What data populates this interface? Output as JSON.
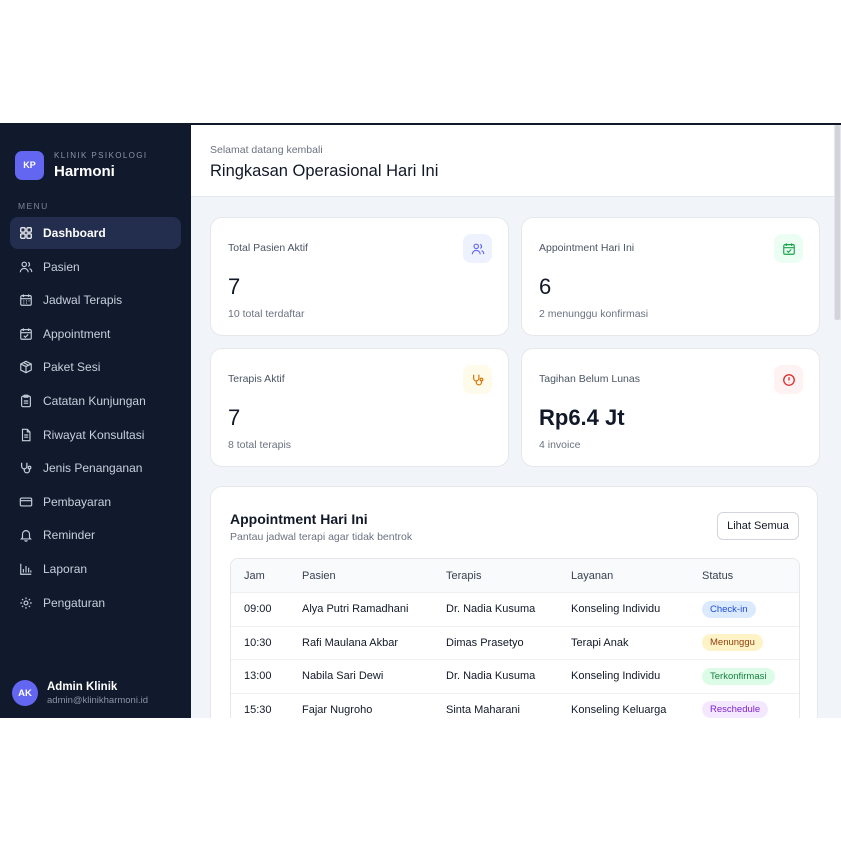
{
  "brand": {
    "logo": "KP",
    "subtitle": "KLINIK PSIKOLOGI",
    "name": "Harmoni"
  },
  "menu_label": "MENU",
  "nav": [
    {
      "label": "Dashboard",
      "icon": "dashboard-icon",
      "active": true
    },
    {
      "label": "Pasien",
      "icon": "users-icon"
    },
    {
      "label": "Jadwal Terapis",
      "icon": "calendar-icon"
    },
    {
      "label": "Appointment",
      "icon": "calendar-check-icon"
    },
    {
      "label": "Paket Sesi",
      "icon": "package-icon"
    },
    {
      "label": "Catatan Kunjungan",
      "icon": "clipboard-icon"
    },
    {
      "label": "Riwayat Konsultasi",
      "icon": "document-icon"
    },
    {
      "label": "Jenis Penanganan",
      "icon": "stethoscope-icon"
    },
    {
      "label": "Pembayaran",
      "icon": "credit-card-icon"
    },
    {
      "label": "Reminder",
      "icon": "bell-icon"
    },
    {
      "label": "Laporan",
      "icon": "bar-chart-icon"
    },
    {
      "label": "Pengaturan",
      "icon": "gear-icon"
    }
  ],
  "user": {
    "initials": "AK",
    "name": "Admin Klinik",
    "email": "admin@klinikharmoni.id"
  },
  "header": {
    "greeting": "Selamat datang kembali",
    "title": "Ringkasan Operasional Hari Ini"
  },
  "stats": [
    {
      "label": "Total Pasien Aktif",
      "value": "7",
      "note": "10 total terdaftar",
      "icon": "users-icon",
      "color": "#6366f1",
      "bg": "#eef2ff"
    },
    {
      "label": "Appointment Hari Ini",
      "value": "6",
      "note": "2 menunggu konfirmasi",
      "icon": "calendar-check-icon",
      "color": "#16a34a",
      "bg": "#ecfdf3"
    },
    {
      "label": "Terapis Aktif",
      "value": "7",
      "note": "8 total terapis",
      "icon": "stethoscope-icon",
      "color": "#d97706",
      "bg": "#fffbeb"
    },
    {
      "label": "Tagihan Belum Lunas",
      "value": "Rp6.4 Jt",
      "note": "4 invoice",
      "icon": "alert-circle-icon",
      "color": "#dc2626",
      "bg": "#fef2f2"
    }
  ],
  "appointments": {
    "title": "Appointment Hari Ini",
    "subtitle": "Pantau jadwal terapi agar tidak bentrok",
    "button": "Lihat Semua",
    "columns": [
      "Jam",
      "Pasien",
      "Terapis",
      "Layanan",
      "Status"
    ],
    "rows": [
      {
        "time": "09:00",
        "patient": "Alya Putri Ramadhani",
        "therapist": "Dr. Nadia Kusuma",
        "service": "Konseling Individu",
        "status": "Check-in",
        "status_color": "#1d4ed8",
        "status_bg": "#dbeafe"
      },
      {
        "time": "10:30",
        "patient": "Rafi Maulana Akbar",
        "therapist": "Dimas Prasetyo",
        "service": "Terapi Anak",
        "status": "Menunggu",
        "status_color": "#92400e",
        "status_bg": "#fef3c7"
      },
      {
        "time": "13:00",
        "patient": "Nabila Sari Dewi",
        "therapist": "Dr. Nadia Kusuma",
        "service": "Konseling Individu",
        "status": "Terkonfirmasi",
        "status_color": "#15803d",
        "status_bg": "#dcfce7"
      },
      {
        "time": "15:30",
        "patient": "Fajar Nugroho",
        "therapist": "Sinta Maharani",
        "service": "Konseling Keluarga",
        "status": "Reschedule",
        "status_color": "#7e22ce",
        "status_bg": "#f3e8ff"
      }
    ]
  }
}
